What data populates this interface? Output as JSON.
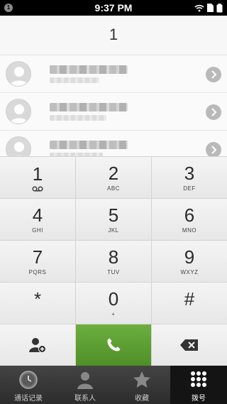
{
  "status_bar": {
    "notification_badge": "1",
    "time": "9:37 PM",
    "icons": [
      "wifi-icon",
      "sim-icon",
      "battery-icon"
    ]
  },
  "dialer": {
    "display_number": "1"
  },
  "contacts": {
    "rows": [
      {
        "avatar": "person-icon",
        "chevron": "chevron-right-icon"
      },
      {
        "avatar": "person-icon",
        "chevron": "chevron-right-icon"
      },
      {
        "avatar": "person-icon",
        "chevron": "chevron-right-icon"
      }
    ]
  },
  "keypad": {
    "keys": [
      {
        "digit": "1",
        "letters": "",
        "icon": "voicemail-icon"
      },
      {
        "digit": "2",
        "letters": "ABC"
      },
      {
        "digit": "3",
        "letters": "DEF"
      },
      {
        "digit": "4",
        "letters": "GHI"
      },
      {
        "digit": "5",
        "letters": "JKL"
      },
      {
        "digit": "6",
        "letters": "MNO"
      },
      {
        "digit": "7",
        "letters": "PQRS"
      },
      {
        "digit": "8",
        "letters": "TUV"
      },
      {
        "digit": "9",
        "letters": "WXYZ"
      },
      {
        "digit": "*",
        "letters": ""
      },
      {
        "digit": "0",
        "letters": "+"
      },
      {
        "digit": "#",
        "letters": ""
      }
    ]
  },
  "actions": {
    "add_contact": "add-contact-icon",
    "call": "phone-icon",
    "backspace": "backspace-icon",
    "call_color": "#5a9b30"
  },
  "tabs": [
    {
      "label": "通话记录",
      "icon": "clock-icon",
      "active": false
    },
    {
      "label": "联系人",
      "icon": "person-icon",
      "active": false
    },
    {
      "label": "收藏",
      "icon": "star-icon",
      "active": false
    },
    {
      "label": "拨号",
      "icon": "keypad-icon",
      "active": true
    }
  ]
}
